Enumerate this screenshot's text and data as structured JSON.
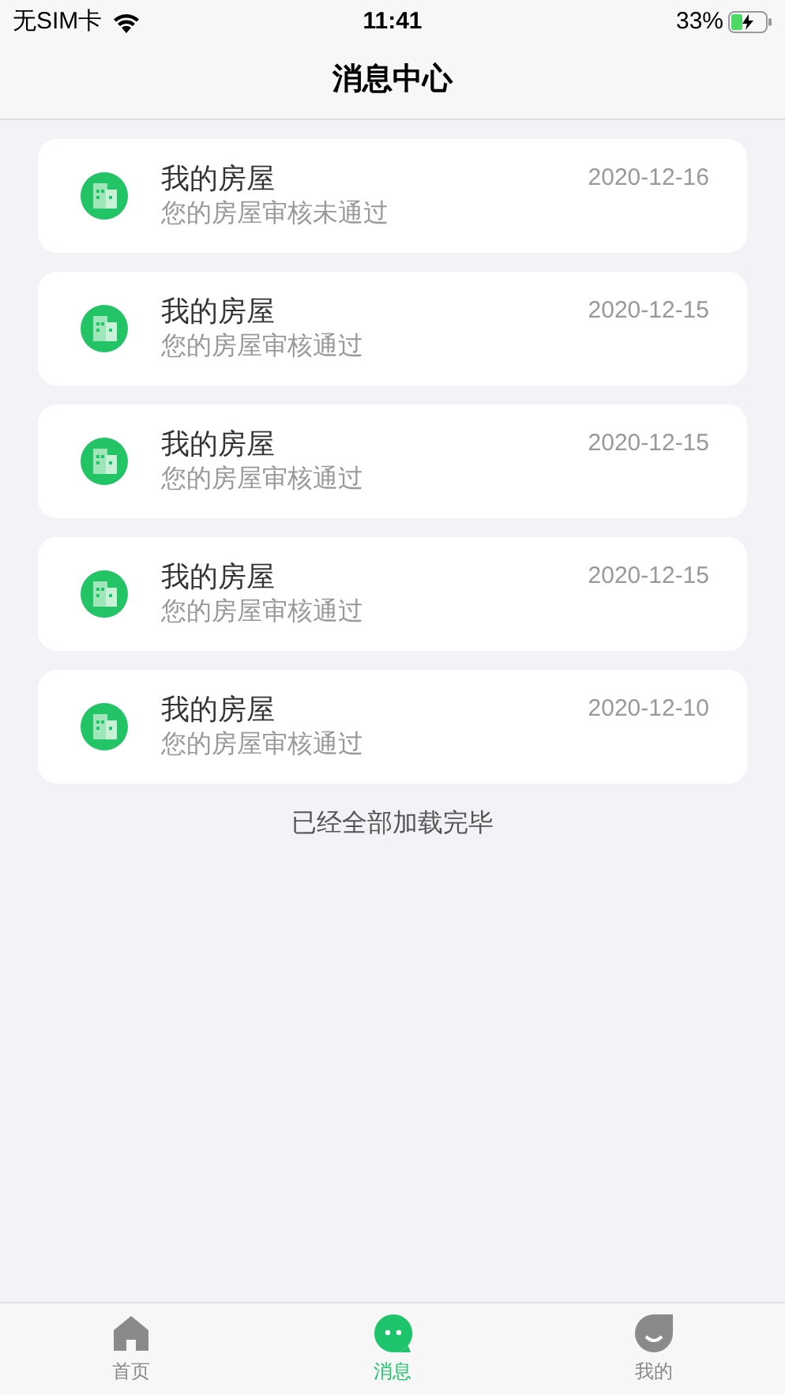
{
  "status_bar": {
    "carrier": "无SIM卡",
    "time": "11:41",
    "battery": "33%"
  },
  "title": "消息中心",
  "messages": [
    {
      "title": "我的房屋",
      "body": "您的房屋审核未通过",
      "date": "2020-12-16"
    },
    {
      "title": "我的房屋",
      "body": "您的房屋审核通过",
      "date": "2020-12-15"
    },
    {
      "title": "我的房屋",
      "body": "您的房屋审核通过",
      "date": "2020-12-15"
    },
    {
      "title": "我的房屋",
      "body": "您的房屋审核通过",
      "date": "2020-12-15"
    },
    {
      "title": "我的房屋",
      "body": "您的房屋审核通过",
      "date": "2020-12-10"
    }
  ],
  "footer": "已经全部加载完毕",
  "tabs": [
    {
      "label": "首页",
      "kind": "home",
      "selected": false
    },
    {
      "label": "消息",
      "kind": "chat",
      "selected": true
    },
    {
      "label": "我的",
      "kind": "profile",
      "selected": false
    }
  ]
}
